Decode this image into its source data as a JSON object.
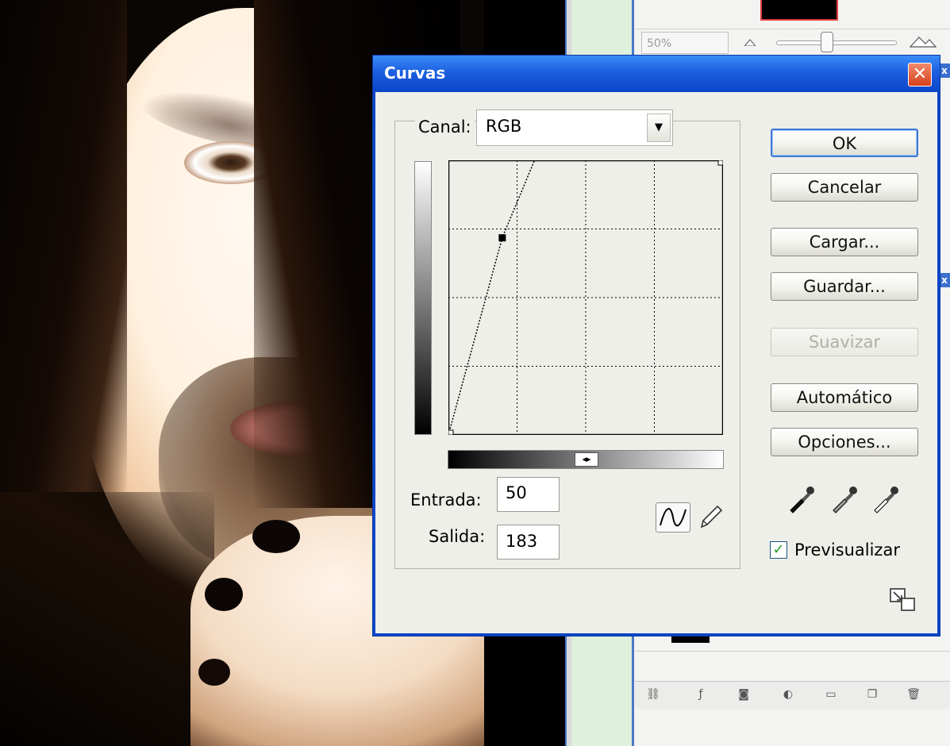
{
  "dialog": {
    "title": "Curvas",
    "close_symbol": "✕",
    "channel": {
      "label": "Canal:",
      "value": "RGB",
      "dropdown_icon": "▼"
    },
    "input": {
      "label": "Entrada:",
      "value": "50"
    },
    "output": {
      "label": "Salida:",
      "value": "183"
    },
    "buttons": {
      "ok": "OK",
      "cancel": "Cancelar",
      "load": "Cargar...",
      "save": "Guardar...",
      "smooth": "Suavizar",
      "auto": "Automático",
      "options": "Opciones..."
    },
    "preview": {
      "label": "Previsualizar",
      "checked": true,
      "check_symbol": "✓"
    },
    "curve_points": [
      {
        "input": 0,
        "output": 0
      },
      {
        "input": 50,
        "output": 183
      },
      {
        "input": 80,
        "output": 255
      },
      {
        "input": 255,
        "output": 255
      }
    ],
    "toggle_symbol": "◂▸",
    "colors": {
      "title_bar": "#0a46c8",
      "accent_border": "#3c78d8",
      "close_button": "#d8401c",
      "check": "#21a121"
    }
  },
  "navigator": {
    "zoom": "50%"
  },
  "layers_toolbar": {
    "icons": [
      "link-icon",
      "fx-icon",
      "mask-icon",
      "adjustment-icon",
      "folder-icon",
      "new-layer-icon",
      "trash-icon"
    ],
    "glyphs": [
      "⛓",
      "ƒ",
      "◙",
      "◐",
      "▭",
      "❐",
      "🗑"
    ]
  },
  "panel_close_symbol": "x"
}
